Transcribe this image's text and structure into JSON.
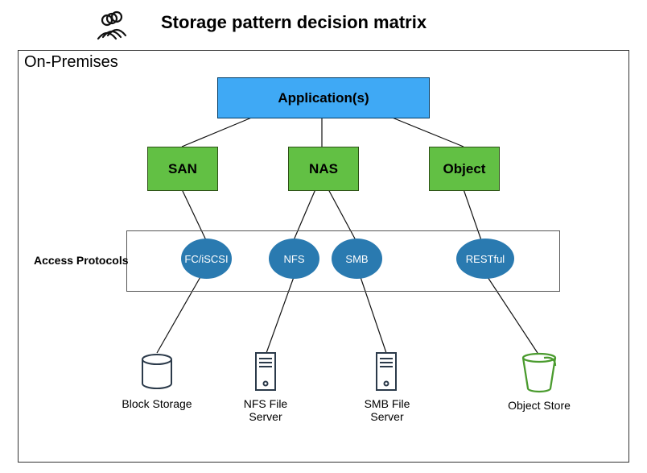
{
  "title": "Storage pattern decision matrix",
  "frame": {
    "label": "On-Premises"
  },
  "application_box": "Application(s)",
  "categories": {
    "san": "SAN",
    "nas": "NAS",
    "object": "Object"
  },
  "protocols": {
    "label": "Access Protocols",
    "fc_iscsi": "FC/iSCSI",
    "nfs": "NFS",
    "smb": "SMB",
    "restful": "RESTful"
  },
  "stores": {
    "block": "Block Storage",
    "nfs_server": "NFS File Server",
    "smb_server": "SMB File Server",
    "object_store": "Object Store"
  }
}
